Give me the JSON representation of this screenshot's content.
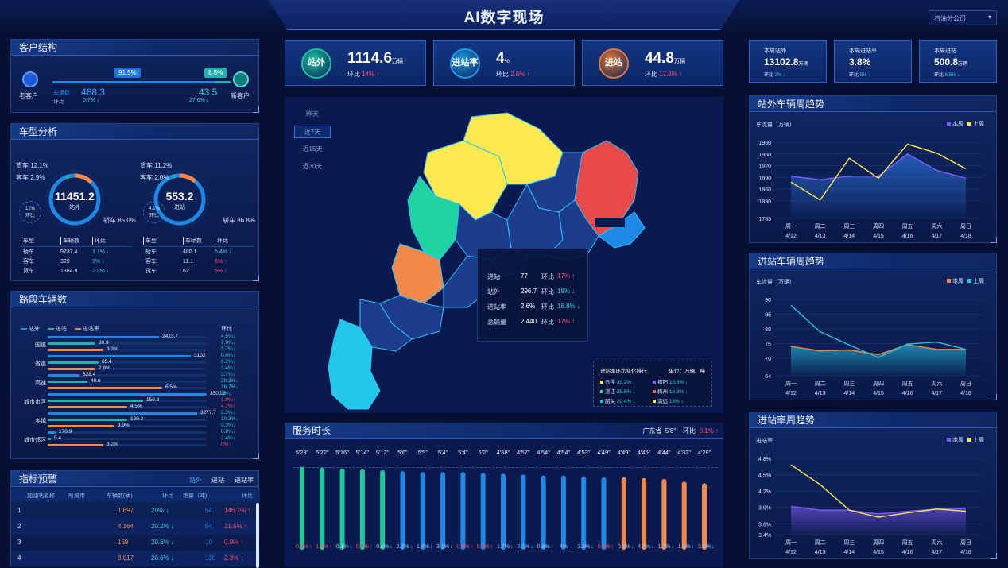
{
  "header": {
    "title": "AI数字现场",
    "company_select": "石油分公司"
  },
  "kpis": [
    {
      "icon_label": "站外",
      "value": "1114.6",
      "unit": "万辆",
      "cmp_label": "环比",
      "cmp": "14%",
      "trend": "up",
      "color": "#19c2a0"
    },
    {
      "icon_label": "进站率",
      "value": "4",
      "unit": "%",
      "cmp_label": "环比",
      "cmp": "2.6%",
      "trend": "up",
      "color": "#1d9be8"
    },
    {
      "icon_label": "进站",
      "value": "44.8",
      "unit": "万辆",
      "cmp_label": "环比",
      "cmp": "17.6%",
      "trend": "up",
      "color": "#e07a3c"
    }
  ],
  "week_kpis": [
    {
      "label": "本周站外",
      "value": "13102.8",
      "unit": "万辆",
      "cmp_label": "环比",
      "cmp": "3%",
      "trend": "down"
    },
    {
      "label": "本周进站率",
      "value": "3.8%",
      "unit": "",
      "cmp_label": "环比",
      "cmp": "5%",
      "trend": "down"
    },
    {
      "label": "本周进站",
      "value": "500.8",
      "unit": "万辆",
      "cmp_label": "环比",
      "cmp": "6.5%",
      "trend": "down"
    }
  ],
  "customer": {
    "title": "客户结构",
    "old_label": "老客户",
    "new_label": "新客户",
    "old_pct": "91.5%",
    "new_pct": "8.5%",
    "old_value": "468.3",
    "new_value": "43.5",
    "old_cmp": "0.7%",
    "new_cmp": "27.6%",
    "vehicle_label": "车辆数",
    "cmp_label": "环比",
    "old_share": 0.915
  },
  "vehicle": {
    "title": "车型分析",
    "left": {
      "value": "11451.2",
      "label": "站外",
      "cmp": "12%",
      "cmp_label": "环比",
      "callouts": [
        "货车 12.1%",
        "客车 2.9%",
        "轿车 85.0%"
      ]
    },
    "right": {
      "value": "553.2",
      "label": "进站",
      "cmp": "4.1%",
      "cmp_label": "环比",
      "callouts": [
        "货车 11.2%",
        "客车 2.0%",
        "轿车 86.8%"
      ]
    },
    "headers": [
      "车型",
      "车辆数",
      "环比"
    ],
    "left_rows": [
      {
        "name": "轿车",
        "count": "9737.4",
        "cmp": "1.1%",
        "trend": "down"
      },
      {
        "name": "客车",
        "count": "329",
        "cmp": "3%",
        "trend": "down"
      },
      {
        "name": "货车",
        "count": "1384.8",
        "cmp": "2.3%",
        "trend": "down"
      }
    ],
    "right_rows": [
      {
        "name": "轿车",
        "count": "480.1",
        "cmp": "5.4%",
        "trend": "down"
      },
      {
        "name": "客车",
        "count": "11.1",
        "cmp": "6%",
        "trend": "up"
      },
      {
        "name": "货车",
        "count": "62",
        "cmp": "5%",
        "trend": "up"
      }
    ]
  },
  "road": {
    "title": "路段车辆数",
    "legend": [
      "站外",
      "进站",
      "进站率"
    ],
    "cmp_header": "环比",
    "groups": [
      {
        "name": "国道",
        "vals": [
          "2423.7",
          "80.9",
          "3.3%"
        ],
        "cmps": [
          "4.5%↓",
          "7.9%↓",
          "5.7%↓"
        ],
        "fracs": [
          0.7,
          0.3,
          0.35
        ]
      },
      {
        "name": "省道",
        "vals": [
          "3102",
          "85.4",
          "2.8%"
        ],
        "cmps": [
          "0.6%↓",
          "6.2%↓",
          "3.4%↓"
        ],
        "fracs": [
          0.9,
          0.32,
          0.3
        ]
      },
      {
        "name": "高速",
        "vals": [
          "628.4",
          "40.6",
          "6.5%"
        ],
        "cmps": [
          "3.7%↓",
          "20.3%↓",
          "16.7%↓"
        ],
        "fracs": [
          0.2,
          0.25,
          0.72
        ]
      },
      {
        "name": "城市市区",
        "vals": [
          "3500.2",
          "159.3",
          "4.5%"
        ],
        "cmps": [
          "3%↓",
          "1.9%↑",
          "4.7%↑"
        ],
        "fracs": [
          1.0,
          0.6,
          0.5
        ]
      },
      {
        "name": "乡镇",
        "vals": [
          "3277.7",
          "129.2",
          "3.9%"
        ],
        "cmps": [
          "2.3%↓",
          "10.3%↓",
          "9.3%↓"
        ],
        "fracs": [
          0.94,
          0.5,
          0.42
        ]
      },
      {
        "name": "城市郊区",
        "vals": [
          "170.9",
          "5.4",
          "3.2%"
        ],
        "cmps": [
          "0.8%↓",
          "2.4%↓",
          "0%↑"
        ],
        "fracs": [
          0.05,
          0.02,
          0.35
        ]
      }
    ]
  },
  "alert": {
    "title": "指标预警",
    "tabs": [
      "站外",
      "进站",
      "进站率"
    ],
    "headers": [
      "加油站名称",
      "所属市",
      "车辆数(辆)",
      "环比",
      "销量（吨)",
      "环比"
    ],
    "rows": [
      {
        "idx": "1",
        "count": "1,697",
        "cmp1": "20%",
        "sales": "54",
        "cmp2": "146.1%"
      },
      {
        "idx": "2",
        "count": "4,164",
        "cmp1": "20.2%",
        "sales": "54",
        "cmp2": "21.5%"
      },
      {
        "idx": "3",
        "count": "169",
        "cmp1": "20.6%",
        "sales": "10",
        "cmp2": "0.9%"
      },
      {
        "idx": "4",
        "count": "8,017",
        "cmp1": "20.6%",
        "sales": "130",
        "cmp2": "2.3%"
      }
    ]
  },
  "map": {
    "time_tabs": [
      "昨天",
      "近7天",
      "近15天",
      "近30天"
    ],
    "active_tab": 1,
    "tooltip": [
      {
        "label": "进站",
        "value": "77",
        "cmp_label": "环比",
        "cmp": "17%",
        "trend": "up"
      },
      {
        "label": "站外",
        "value": "296.7",
        "cmp_label": "环比",
        "cmp": "18%",
        "trend": "down"
      },
      {
        "label": "进站率",
        "value": "2.6%",
        "cmp_label": "环比",
        "cmp": "18.8%",
        "trend": "down"
      },
      {
        "label": "总销量",
        "value": "2,440",
        "cmp_label": "环比",
        "cmp": "17%",
        "trend": "up"
      }
    ],
    "rank_title": "进站率环比变化排行",
    "rank_unit": "单位：万辆、吨",
    "rank": [
      {
        "name": "云浮",
        "pct": "30.2%",
        "color": "#ffe94f"
      },
      {
        "name": "湛江",
        "pct": "25.6%",
        "color": "#20d3a3"
      },
      {
        "name": "韶关",
        "pct": "20.4%",
        "color": "#22c7e8"
      },
      {
        "name": "揭阳",
        "pct": "18.8%",
        "color": "#7d5cff"
      },
      {
        "name": "梅州",
        "pct": "18.3%",
        "color": "#ff5a5a"
      },
      {
        "name": "清远",
        "pct": "18%",
        "color": "#ffe94f"
      }
    ]
  },
  "service": {
    "title": "服务时长",
    "region": "广东省",
    "region_value": "5'8\"",
    "cmp_label": "环比",
    "cmp": "0.1%",
    "bars": [
      {
        "t": "5'23\"",
        "c": "0.8%",
        "tr": "up",
        "v": 0.95,
        "col": "#1fc99a"
      },
      {
        "t": "5'22\"",
        "c": "1.4%",
        "tr": "up",
        "v": 0.94,
        "col": "#1fc99a"
      },
      {
        "t": "5'16\"",
        "c": "0.1%",
        "tr": "down",
        "v": 0.93,
        "col": "#1fc99a"
      },
      {
        "t": "5'14\"",
        "c": "0.7%",
        "tr": "up",
        "v": 0.92,
        "col": "#1fc99a"
      },
      {
        "t": "5'12\"",
        "c": "0.6%",
        "tr": "down",
        "v": 0.91,
        "col": "#1fc99a"
      },
      {
        "t": "5'6\"",
        "c": "2.2%",
        "tr": "down",
        "v": 0.9,
        "col": "#1e88e5"
      },
      {
        "t": "5'5\"",
        "c": "1.4%",
        "tr": "down",
        "v": 0.89,
        "col": "#1e88e5"
      },
      {
        "t": "5'4\"",
        "c": "3.1%",
        "tr": "down",
        "v": 0.89,
        "col": "#1e88e5"
      },
      {
        "t": "5'4\"",
        "c": "0.9%",
        "tr": "up",
        "v": 0.89,
        "col": "#1e88e5"
      },
      {
        "t": "5'2\"",
        "c": "0.3%",
        "tr": "up",
        "v": 0.88,
        "col": "#1e88e5"
      },
      {
        "t": "4'58\"",
        "c": "1.7%",
        "tr": "down",
        "v": 0.87,
        "col": "#1e88e5"
      },
      {
        "t": "4'57\"",
        "c": "2.1%",
        "tr": "down",
        "v": 0.86,
        "col": "#1e88e5"
      },
      {
        "t": "4'54\"",
        "c": "0.8%",
        "tr": "down",
        "v": 0.85,
        "col": "#1e88e5"
      },
      {
        "t": "4'54\"",
        "c": "4%",
        "tr": "down",
        "v": 0.85,
        "col": "#1e88e5"
      },
      {
        "t": "4'53\"",
        "c": "2.3%",
        "tr": "down",
        "v": 0.84,
        "col": "#1e88e5"
      },
      {
        "t": "4'49\"",
        "c": "0.6%",
        "tr": "up",
        "v": 0.83,
        "col": "#1e88e5"
      },
      {
        "t": "4'49\"",
        "c": "0.5%",
        "tr": "down",
        "v": 0.83,
        "col": "#f0894a"
      },
      {
        "t": "4'45\"",
        "c": "4.3%",
        "tr": "down",
        "v": 0.82,
        "col": "#f0894a"
      },
      {
        "t": "4'44\"",
        "c": "1.7%",
        "tr": "down",
        "v": 0.81,
        "col": "#f0894a"
      },
      {
        "t": "4'33\"",
        "c": "1.9%",
        "tr": "down",
        "v": 0.78,
        "col": "#f0894a"
      },
      {
        "t": "4'28\"",
        "c": "3.5%",
        "tr": "down",
        "v": 0.76,
        "col": "#f0894a"
      }
    ]
  },
  "trends": [
    {
      "title": "站外车辆周趋势",
      "ylabel": "车流量（万辆）",
      "legend": [
        "本周",
        "上周"
      ],
      "colors": [
        "#7d5cff",
        "#ffe94f"
      ],
      "fill": "#2a6fd6",
      "yticks": [
        "1980",
        "1950",
        "1920",
        "1890",
        "1860",
        "1830",
        "1785"
      ],
      "ymin": 1785,
      "ymax": 1980,
      "x": [
        "周一",
        "周二",
        "周三",
        "周四",
        "周五",
        "周六",
        "周日"
      ],
      "dates": [
        "4/12",
        "4/13",
        "4/14",
        "4/15",
        "4/16",
        "4/17",
        "4/18"
      ],
      "series": [
        [
          1893,
          1884,
          1893,
          1893,
          1950,
          1908,
          1888
        ],
        [
          1878,
          1832,
          1939,
          1888,
          1975,
          1952,
          1912
        ]
      ]
    },
    {
      "title": "进站车辆周趋势",
      "ylabel": "车流量（万辆）",
      "legend": [
        "本周",
        "上周"
      ],
      "colors": [
        "#f0894a",
        "#22c7d8"
      ],
      "fill": "#22a8c8",
      "yticks": [
        "90",
        "85",
        "80",
        "75",
        "70",
        "64"
      ],
      "ymin": 64,
      "ymax": 90,
      "x": [
        "周一",
        "周二",
        "周三",
        "周四",
        "周五",
        "周六",
        "周日"
      ],
      "dates": [
        "4/12",
        "4/13",
        "4/14",
        "4/15",
        "4/16",
        "4/17",
        "4/18"
      ],
      "series": [
        [
          74,
          72.5,
          72.8,
          71.2,
          74.6,
          73,
          73
        ],
        [
          88,
          79,
          74.5,
          70.2,
          74.8,
          75.5,
          73
        ]
      ]
    },
    {
      "title": "进站率周趋势",
      "ylabel": "进站率",
      "legend": [
        "本周",
        "上周"
      ],
      "colors": [
        "#7d5cff",
        "#ffe94f"
      ],
      "fill": "#6b4fd6",
      "yticks": [
        "4.8%",
        "4.5%",
        "4.2%",
        "3.9%",
        "3.6%",
        "3.4%"
      ],
      "ymin": 3.4,
      "ymax": 4.8,
      "x": [
        "周一",
        "周二",
        "周三",
        "周四",
        "周五",
        "周六",
        "周日"
      ],
      "dates": [
        "4/12",
        "4/13",
        "4/14",
        "4/15",
        "4/16",
        "4/17",
        "4/18"
      ],
      "series": [
        [
          3.92,
          3.85,
          3.85,
          3.78,
          3.83,
          3.87,
          3.88
        ],
        [
          4.68,
          4.32,
          3.85,
          3.72,
          3.8,
          3.87,
          3.83
        ]
      ]
    }
  ]
}
